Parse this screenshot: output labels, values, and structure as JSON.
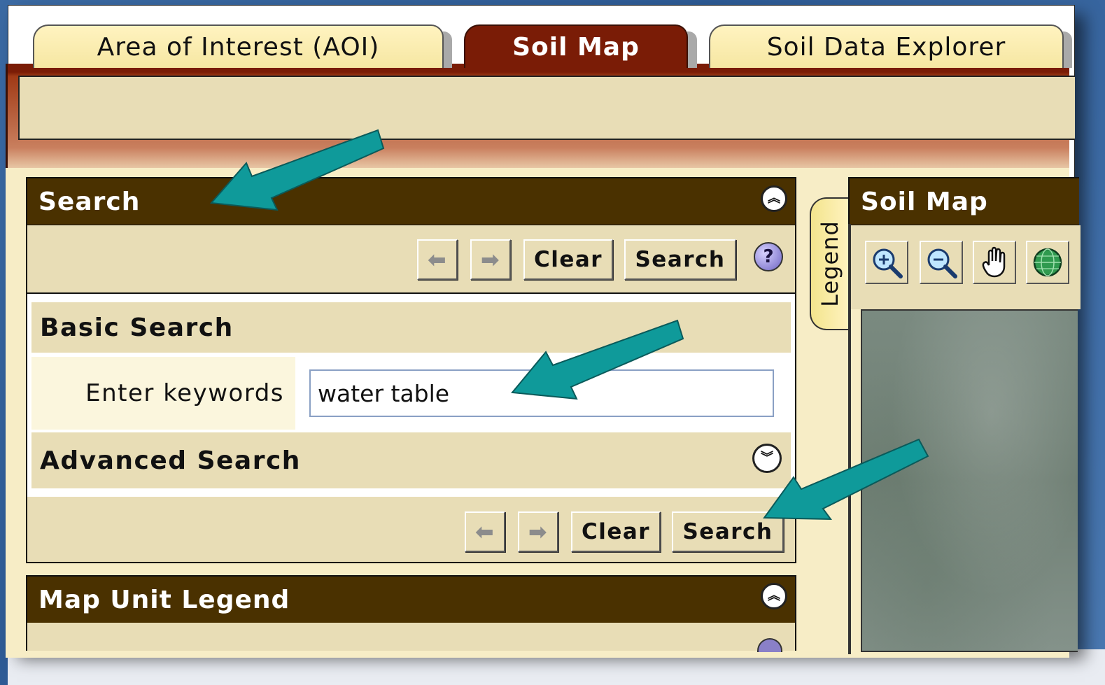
{
  "tabs": [
    {
      "label": "Area of Interest (AOI)",
      "active": false
    },
    {
      "label": "Soil Map",
      "active": true
    },
    {
      "label": "Soil Data Explorer",
      "active": false
    }
  ],
  "search_panel": {
    "title": "Search",
    "toolbar": {
      "back_icon": "left-arrow-icon",
      "forward_icon": "right-arrow-icon",
      "clear_label": "Clear",
      "search_label": "Search",
      "help_label": "?"
    },
    "basic_search": {
      "title": "Basic Search",
      "keywords_label": "Enter keywords",
      "keywords_value": "water table"
    },
    "advanced_search": {
      "title": "Advanced Search"
    },
    "bottom_toolbar": {
      "clear_label": "Clear",
      "search_label": "Search"
    }
  },
  "map_unit_legend": {
    "title": "Map Unit Legend"
  },
  "legend_tab": {
    "label": "Legend"
  },
  "soil_map_panel": {
    "title": "Soil Map",
    "tools": [
      "zoom-in-icon",
      "zoom-out-icon",
      "pan-hand-icon",
      "globe-icon"
    ]
  },
  "colors": {
    "panel_header": "#4a3100",
    "active_tab": "#7a1c06",
    "inactive_tab": "#f6e7a2",
    "panel_bg": "#e8ddb6",
    "annotation_arrow": "#0f9a9a"
  }
}
